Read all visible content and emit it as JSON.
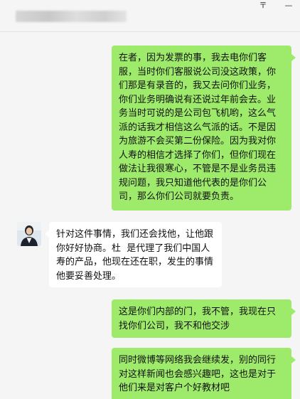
{
  "window": {
    "pin_glyph": "〒",
    "minimize_glyph": "—"
  },
  "messages": [
    {
      "sender": "me",
      "text": "在者，因为发票的事，我去电你们客服，当时你们客服说公司没这政策，你们那是有录音的，我又去问你们业务，你们业务明确说有还说过年前会去。业务当时可说的是公司包飞机哟，这么气派的话我才相信这么气派的话。不是因为旅游不会买第二份保险。因为我对你人寿的相信才选择了你们，但你们现在做法让我很寒心，不管是不是业务员违规问题，我只知道他代表的是你们公司，那么你们公司就要负责。"
    },
    {
      "sender": "them",
      "text": "针对这件事情，我们还会找他，让他跟你好好协商。杜  是代理了我们中国人寿的产品，他现在还在职，发生的事情他要妥善处理。"
    },
    {
      "sender": "me",
      "text": "这是你们内部的门，我不管，我现在只找你们公司，我不和他交涉"
    },
    {
      "sender": "me",
      "text": "同时微博等网络我会继续发，别的同行对这样新闻也会感兴趣吧，这也是对于他们来是对客户个好教材吧"
    }
  ]
}
